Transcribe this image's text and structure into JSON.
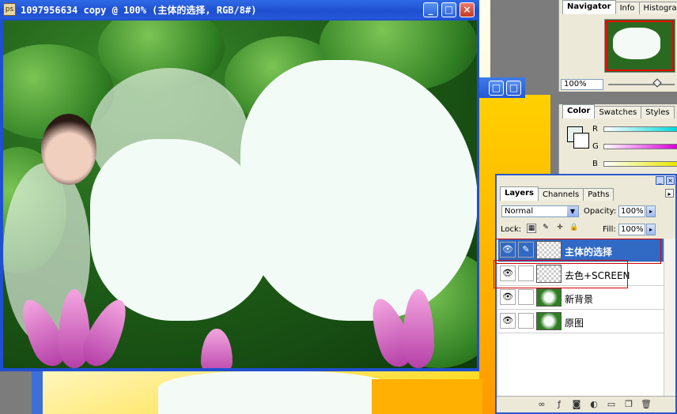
{
  "document": {
    "title": "1097956634 copy @ 100% (主体的选择, RGB/8#)",
    "icon": "ps"
  },
  "window_buttons": {
    "minimize": "_",
    "maximize": "□",
    "close": "×"
  },
  "navigator": {
    "tabs": [
      "Navigator",
      "Info",
      "Histogra"
    ],
    "zoom": "100%"
  },
  "color": {
    "tabs": [
      "Color",
      "Swatches",
      "Styles"
    ],
    "channels": [
      "R",
      "G",
      "B"
    ],
    "bar_colors": [
      "#00d8d8",
      "#d800d8",
      "#e8e800"
    ]
  },
  "layers": {
    "tabs": [
      "Layers",
      "Channels",
      "Paths"
    ],
    "blend_mode": "Normal",
    "opacity_label": "Opacity:",
    "opacity": "100%",
    "lock_label": "Lock:",
    "fill_label": "Fill:",
    "fill": "100%",
    "items": [
      {
        "name": "主体的选择",
        "selected": true
      },
      {
        "name": "去色+SCREEN",
        "selected": false
      },
      {
        "name": "新背景",
        "selected": false
      },
      {
        "name": "原图",
        "selected": false
      }
    ]
  }
}
